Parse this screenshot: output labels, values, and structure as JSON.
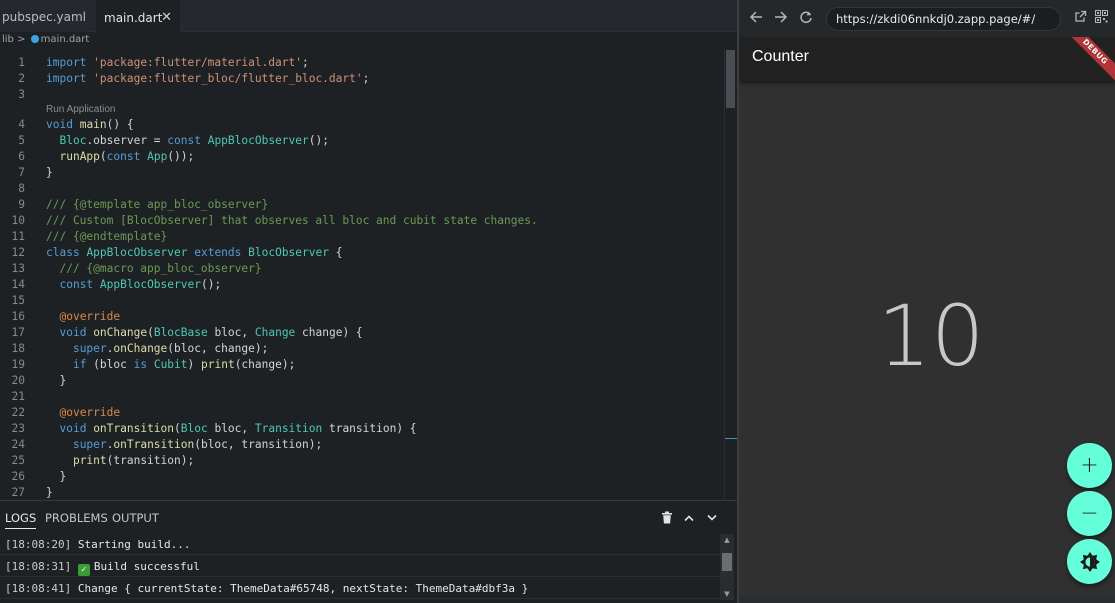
{
  "editor": {
    "tabs": [
      {
        "label": "pubspec.yaml"
      },
      {
        "label": "main.dart"
      }
    ],
    "close_glyph": "✕",
    "breadcrumb": {
      "folder": "lib",
      "sep": ">",
      "file": "main.dart"
    },
    "code_lens": "Run Application",
    "line_numbers": [
      "1",
      "2",
      "3",
      "4",
      "5",
      "6",
      "7",
      "8",
      "9",
      "10",
      "11",
      "12",
      "13",
      "14",
      "15",
      "16",
      "17",
      "18",
      "19",
      "20",
      "21",
      "22",
      "23",
      "24",
      "25",
      "26",
      "27"
    ]
  },
  "panel": {
    "tabs": {
      "logs": "LOGS",
      "problems": "PROBLEMS",
      "output": "OUTPUT"
    },
    "logs": [
      {
        "time": "[18:08:20]",
        "text": "Starting build..."
      },
      {
        "time": "[18:08:31]",
        "text": "Build successful"
      },
      {
        "time": "[18:08:41]",
        "text": "Change { currentState: ThemeData#65748, nextState: ThemeData#dbf3a }"
      }
    ]
  },
  "browser": {
    "url": "https://zkdi06nnkdj0.zapp.page/#/"
  },
  "app": {
    "title": "Counter",
    "debug_banner": "DEBUG",
    "counter_value": "10",
    "fab_increment": "+",
    "fab_decrement": "−"
  },
  "colors": {
    "accent": "#64ffda",
    "keyword": "#569cd6",
    "string": "#ce9178",
    "class": "#4ec9b0",
    "comment": "#6a9955",
    "annotation": "#d88a4a"
  }
}
